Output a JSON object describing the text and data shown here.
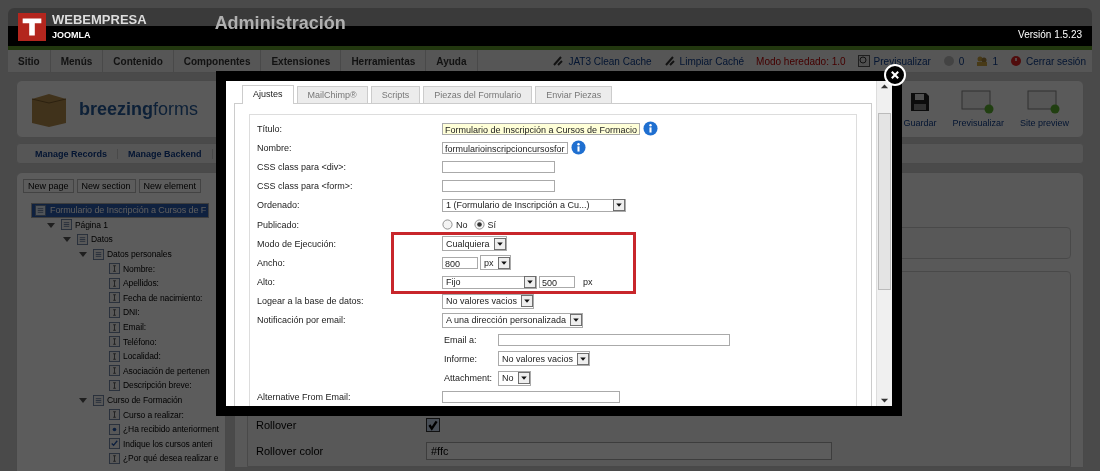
{
  "header": {
    "logo_top": "WEBEMPRESA",
    "logo_bottom": "JOOMLA",
    "title": "Administración",
    "version": "Versión 1.5.23"
  },
  "menu": [
    "Sitio",
    "Menús",
    "Contenido",
    "Componentes",
    "Extensiones",
    "Herramientas",
    "Ayuda"
  ],
  "status_links": [
    {
      "kind": "cache",
      "label": "JAT3 Clean Cache"
    },
    {
      "kind": "clean",
      "label": "Limpiar Caché"
    },
    {
      "kind": "mode",
      "label": "Modo heredado: 1.0"
    },
    {
      "kind": "preview",
      "label": "Previsualizar"
    },
    {
      "kind": "messages",
      "label": "0"
    },
    {
      "kind": "users",
      "label": "1"
    },
    {
      "kind": "logout",
      "label": "Cerrar sesión"
    }
  ],
  "toolbar": {
    "logo": "**breezing**forms",
    "buttons": [
      {
        "kind": "save",
        "label": "Guardar"
      },
      {
        "kind": "preview",
        "label": "Previsualizar"
      },
      {
        "kind": "preview",
        "label": "Site preview"
      }
    ]
  },
  "submenu": [
    "Manage Records",
    "Manage Backend"
  ],
  "tree_buttons": [
    "New page",
    "New section",
    "New element"
  ],
  "tree": [
    {
      "label": "Formulario de Inscripción a Cursos de F",
      "kind": "form",
      "selected": true,
      "children": [
        {
          "label": "Página 1",
          "kind": "page",
          "selected": false,
          "expanded": true,
          "children": [
            {
              "label": "Datos",
              "kind": "section",
              "selected": false,
              "expanded": true,
              "children": [
                {
                  "label": "Datos personales",
                  "kind": "section",
                  "selected": false,
                  "expanded": true,
                  "children": [
                    {
                      "label": "Nombre:",
                      "kind": "text",
                      "selected": false
                    },
                    {
                      "label": "Apellidos:",
                      "kind": "text",
                      "selected": false
                    },
                    {
                      "label": "Fecha de nacimiento:",
                      "kind": "date",
                      "selected": false
                    },
                    {
                      "label": "DNI:",
                      "kind": "text",
                      "selected": false
                    },
                    {
                      "label": "Email:",
                      "kind": "text",
                      "selected": false
                    },
                    {
                      "label": "Teléfono:",
                      "kind": "text",
                      "selected": false
                    },
                    {
                      "label": "Localidad:",
                      "kind": "text",
                      "selected": false
                    },
                    {
                      "label": "Asociación de pertenen",
                      "kind": "text",
                      "selected": false
                    },
                    {
                      "label": "Descripción breve:",
                      "kind": "textarea",
                      "selected": false
                    }
                  ]
                },
                {
                  "label": "Curso de Formación",
                  "kind": "section",
                  "selected": false,
                  "expanded": true,
                  "children": [
                    {
                      "label": "Curso a realizar:",
                      "kind": "select",
                      "selected": false
                    },
                    {
                      "label": "¿Ha recibido anteriorment",
                      "kind": "radio",
                      "selected": false
                    },
                    {
                      "label": "Indique los cursos anteri",
                      "kind": "checkbox",
                      "selected": false
                    },
                    {
                      "label": "¿Por qué desea realizar e",
                      "kind": "textarea",
                      "selected": false
                    }
                  ]
                }
              ]
            }
          ]
        }
      ]
    }
  ],
  "properties": [
    {
      "kind": "checkbox",
      "label": "Rollover",
      "checked": true
    },
    {
      "kind": "text",
      "label": "Rollover color",
      "value": "#ffc"
    }
  ],
  "dialog": {
    "tabs": [
      {
        "label": "Ajustes",
        "selected": true
      },
      {
        "label": "MailChimp®",
        "selected": false
      },
      {
        "label": "Scripts",
        "selected": false
      },
      {
        "label": "Piezas del Formulario",
        "selected": false
      },
      {
        "label": "Enviar Piezas",
        "selected": false
      }
    ],
    "rows": [
      {
        "label": "Título:",
        "controls": [
          {
            "kind": "input",
            "value": "Formulario de Inscripción a Cursos de Formacio",
            "focused": true
          },
          {
            "kind": "info"
          }
        ]
      },
      {
        "label": "Nombre:",
        "controls": [
          {
            "kind": "input",
            "value": "formularioinscripcioncursosfor",
            "focused": false
          },
          {
            "kind": "info"
          }
        ]
      },
      {
        "label": "CSS class para <div>:",
        "controls": [
          {
            "kind": "input",
            "focused": false
          }
        ]
      },
      {
        "label": "CSS class para <form>:",
        "controls": [
          {
            "kind": "input",
            "focused": false
          }
        ]
      },
      {
        "label": "Ordenado:",
        "controls": [
          {
            "kind": "select",
            "value": "1 (Formulario de Inscripción a Cu...)"
          }
        ]
      },
      {
        "label": "Publicado:",
        "controls": [
          {
            "kind": "radio",
            "label": "No",
            "selected": false
          },
          {
            "kind": "radio",
            "label": "Sí",
            "selected": true
          }
        ]
      },
      {
        "label": "Modo de Ejecución:",
        "controls": [
          {
            "kind": "select",
            "value": "Cualquiera"
          }
        ]
      },
      {
        "label": "Ancho:",
        "controls": [
          {
            "kind": "input",
            "value": "800",
            "focused": false
          },
          {
            "kind": "select",
            "value": "px"
          }
        ]
      },
      {
        "label": "Alto:",
        "controls": [
          {
            "kind": "select",
            "value": "Fijo"
          },
          {
            "kind": "input",
            "value": "500",
            "focused": false
          },
          {
            "kind": "unit",
            "value": "px"
          }
        ]
      },
      {
        "label": "Logear a la base de datos:",
        "controls": [
          {
            "kind": "select",
            "value": "No valores vacios"
          }
        ]
      },
      {
        "label": "Notificación por email:",
        "controls": [
          {
            "kind": "select",
            "value": "A una dirección personalizada"
          }
        ]
      },
      {
        "label": "Email a:",
        "sub": true,
        "controls": [
          {
            "kind": "input",
            "focused": false
          }
        ]
      },
      {
        "label": "Informe:",
        "sub": true,
        "controls": [
          {
            "kind": "select",
            "value": "No valores vacios"
          }
        ]
      },
      {
        "label": "Attachment:",
        "sub": true,
        "controls": [
          {
            "kind": "select",
            "value": "No"
          }
        ]
      },
      {
        "label": "Alternative From Email:",
        "controls": [
          {
            "kind": "input",
            "focused": false
          }
        ]
      }
    ]
  }
}
